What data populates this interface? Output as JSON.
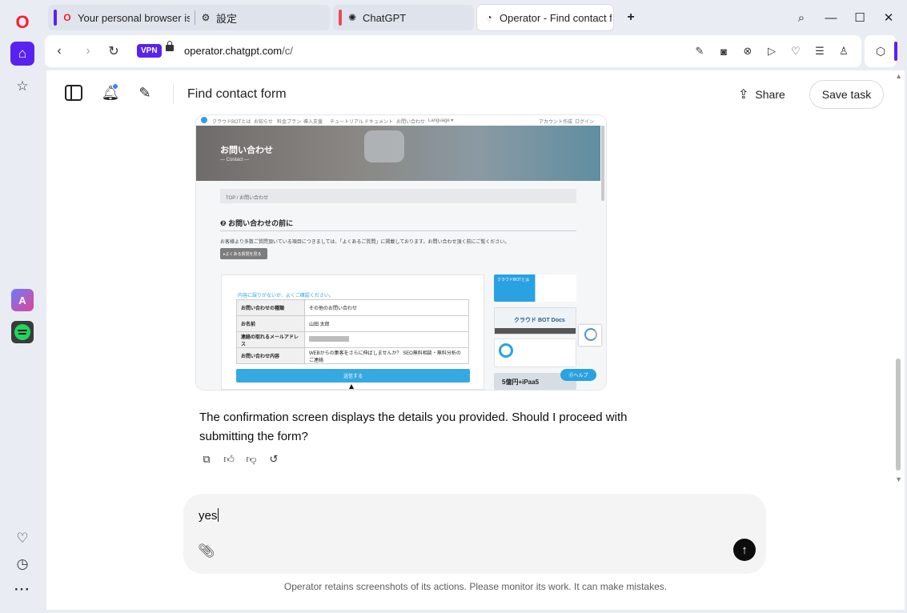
{
  "browser": {
    "tabs": [
      {
        "title": "Your personal browser is a",
        "accent": "#5a22f0"
      },
      {
        "title": "設定",
        "accent": "#5a22f0"
      },
      {
        "title": "ChatGPT",
        "accent": "#e64a5c"
      },
      {
        "title": "Operator - Find contact fo",
        "accent": "#5a22f0",
        "active": true
      }
    ],
    "new_tab": "+",
    "vpn": "VPN",
    "url_host": "operator.chatgpt.com",
    "url_path": "/c/"
  },
  "rail": {
    "opera_logo": "O",
    "aria_label": "A"
  },
  "header": {
    "title": "Find contact form",
    "share_label": "Share",
    "save_task_label": "Save task"
  },
  "screenshot": {
    "nav_links": [
      "クラウドBOTとは",
      "お知らせ",
      "料金プラン",
      "導入支援",
      "チュートリアル",
      "ドキュメント",
      "お問い合わせ",
      "Language ▾"
    ],
    "nav_right": [
      "アカウント作成",
      "ログイン"
    ],
    "hero_title": "お問い合わせ",
    "hero_sub": "— Contact —",
    "breadcrumb": "TOP / お問い合わせ",
    "section_title": "❷ お問い合わせの前に",
    "section_text": "お客様より多数ご質問頂いている項目につきましては、「よくあるご質問」に掲載しております。お問い合わせ頂く前にご覧ください。",
    "faq_button": "▸よくある質問を見る",
    "form_hint": "内容に誤りがないか、よくご確認ください。",
    "rows": [
      {
        "label": "お問い合わせの種類",
        "value": "その他のお問い合わせ"
      },
      {
        "label": "お名前",
        "value": "山田 太郎"
      },
      {
        "label": "連絡の取れるメールアドレス",
        "value": ""
      },
      {
        "label": "お問い合わせ内容",
        "value": "WEBからの集客をさらに伸ばしませんか？ SEO無料相談・無料分析のご連絡"
      }
    ],
    "submit": "送信する",
    "side_1": "クラウドBOTとは",
    "side_2": "クラウド BOT Docs",
    "side_4": "5億円+iPaa5",
    "help": "⓪ヘルプ"
  },
  "message": {
    "text": "The confirmation screen displays the details you provided. Should I proceed with submitting the form?"
  },
  "composer": {
    "input_value": "yes"
  },
  "footer": {
    "disclaimer": "Operator retains screenshots of its actions. Please monitor its work. It can make mistakes."
  }
}
